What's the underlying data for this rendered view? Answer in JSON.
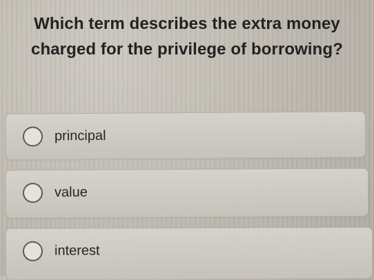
{
  "question": {
    "text": "Which term describes the extra money charged for the privilege of borrowing?"
  },
  "options": [
    {
      "label": "principal",
      "selected": false
    },
    {
      "label": "value",
      "selected": false
    },
    {
      "label": "interest",
      "selected": false
    }
  ]
}
